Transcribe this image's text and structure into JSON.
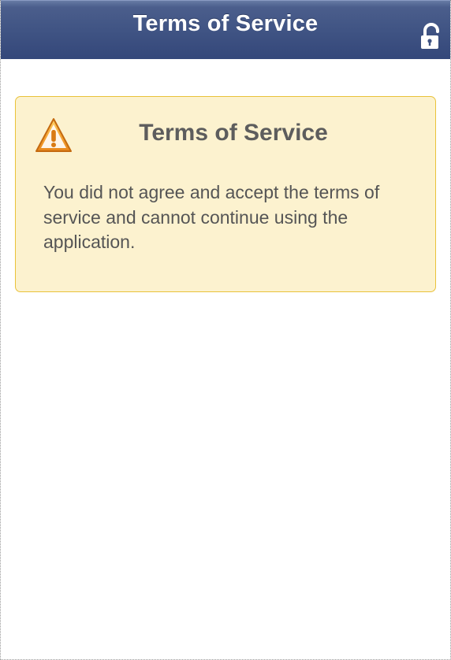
{
  "header": {
    "title": "Terms of Service",
    "lock_icon": "unlocked-padlock-icon"
  },
  "alert": {
    "icon": "warning-triangle-icon",
    "title": "Terms of Service",
    "message": "You did not agree and accept the terms of service and cannot continue using the application."
  },
  "colors": {
    "header_bg": "#3f5383",
    "header_text": "#ffffff",
    "alert_bg": "#fcf2cf",
    "alert_border": "#e9c23a",
    "alert_title": "#5d5d5d",
    "alert_text": "#555555",
    "warning_orange": "#f5a623"
  }
}
